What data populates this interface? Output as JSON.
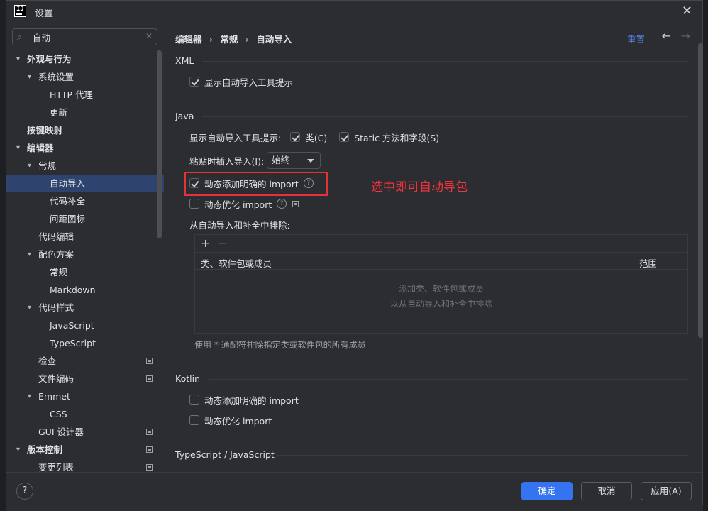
{
  "window": {
    "title": "设置",
    "logo": "IJ"
  },
  "search": {
    "value": "自动"
  },
  "tree": [
    {
      "label": "外观与行为",
      "level": 0,
      "expanded": true,
      "bold": true
    },
    {
      "label": "系统设置",
      "level": 1,
      "expanded": true
    },
    {
      "label": "HTTP 代理",
      "level": 2
    },
    {
      "label": "更新",
      "level": 2
    },
    {
      "label": "按键映射",
      "level": 0,
      "bold": true
    },
    {
      "label": "编辑器",
      "level": 0,
      "expanded": true,
      "bold": true
    },
    {
      "label": "常规",
      "level": 1,
      "expanded": true
    },
    {
      "label": "自动导入",
      "level": 2,
      "selected": true
    },
    {
      "label": "代码补全",
      "level": 2
    },
    {
      "label": "间距图标",
      "level": 2
    },
    {
      "label": "代码编辑",
      "level": 1
    },
    {
      "label": "配色方案",
      "level": 1,
      "expanded": true
    },
    {
      "label": "常规",
      "level": 2
    },
    {
      "label": "Markdown",
      "level": 2
    },
    {
      "label": "代码样式",
      "level": 1,
      "expanded": true
    },
    {
      "label": "JavaScript",
      "level": 2
    },
    {
      "label": "TypeScript",
      "level": 2
    },
    {
      "label": "检查",
      "level": 1,
      "badge": true
    },
    {
      "label": "文件编码",
      "level": 1,
      "badge": true
    },
    {
      "label": "Emmet",
      "level": 1,
      "expanded": true
    },
    {
      "label": "CSS",
      "level": 2
    },
    {
      "label": "GUI 设计器",
      "level": 1,
      "badge": true
    },
    {
      "label": "版本控制",
      "level": 0,
      "expanded": true,
      "bold": true,
      "badge": true
    },
    {
      "label": "变更列表",
      "level": 1,
      "badge": true
    }
  ],
  "breadcrumb": [
    "编辑器",
    "常规",
    "自动导入"
  ],
  "crumb_sep": "›",
  "header": {
    "reset": "重置"
  },
  "xml": {
    "title": "XML",
    "show_popup": {
      "label": "显示自动导入工具提示",
      "checked": true
    }
  },
  "java": {
    "title": "Java",
    "popup_label": "显示自动导入工具提示:",
    "classes": {
      "label": "类(C)",
      "checked": true
    },
    "static": {
      "label": "Static 方法和字段(S)",
      "checked": true
    },
    "paste_label": "粘贴时插入导入(I):",
    "paste_value": "始终",
    "add_unambiguous": {
      "label": "动态添加明确的 import",
      "checked": true
    },
    "optimize": {
      "label": "动态优化 import",
      "checked": false
    },
    "exclude_title": "从自动导入和补全中排除:",
    "col_class": "类、软件包或成员",
    "col_scope": "范围",
    "empty_line1": "添加类、软件包或成员",
    "empty_line2": "以从自动导入和补全中排除",
    "hint": "使用 * 通配符排除指定类或软件包的所有成员"
  },
  "annotation": "选中即可自动导包",
  "kotlin": {
    "title": "Kotlin",
    "add_unambiguous": {
      "label": "动态添加明确的 import",
      "checked": false
    },
    "optimize": {
      "label": "动态优化 import",
      "checked": false
    }
  },
  "typescript": {
    "title": "TypeScript / JavaScript"
  },
  "footer": {
    "help": "?",
    "ok": "确定",
    "cancel": "取消",
    "apply": "应用(A)"
  },
  "colors": {
    "accent": "#3574f0",
    "selection": "#2e436e",
    "annotation": "#f2333d",
    "link": "#548af7"
  }
}
